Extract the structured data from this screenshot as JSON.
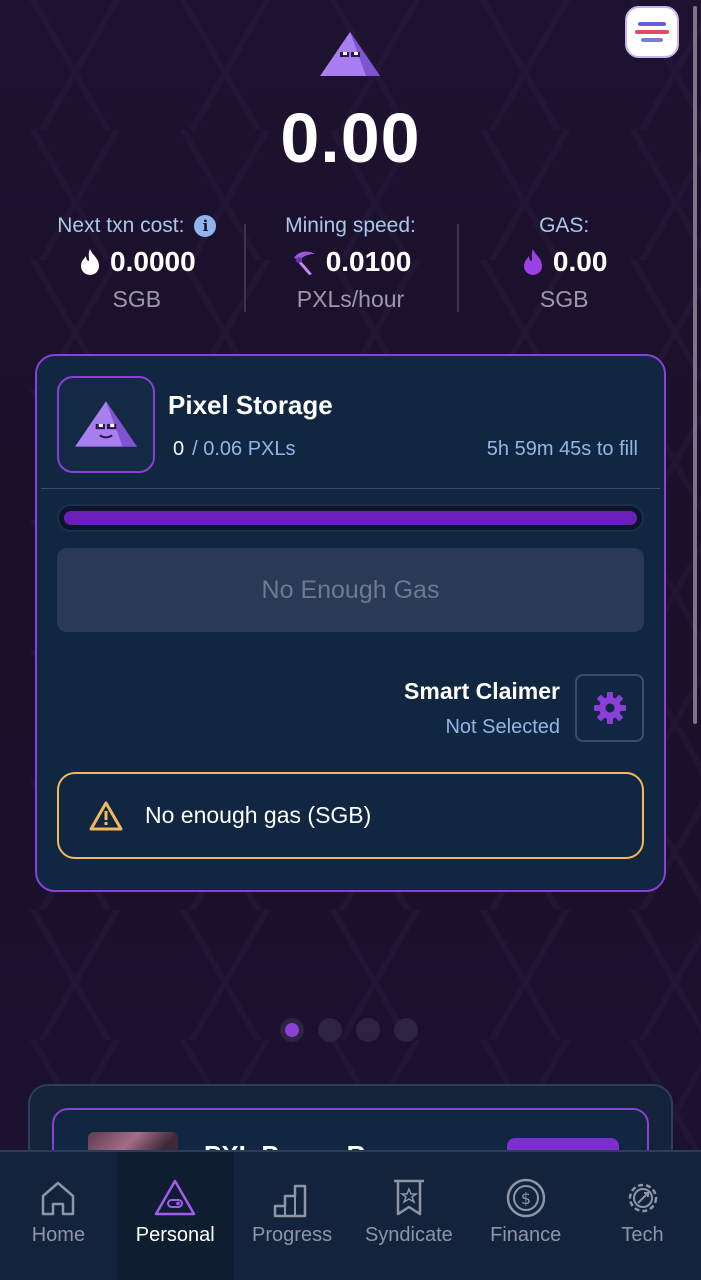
{
  "balance": "0.00",
  "stats": [
    {
      "label": "Next txn cost:",
      "has_info": true,
      "icon": "flame-icon",
      "value": "0.0000",
      "unit": "SGB"
    },
    {
      "label": "Mining speed:",
      "has_info": false,
      "icon": "pickaxe-icon",
      "value": "0.0100",
      "unit": "PXLs/hour"
    },
    {
      "label": "GAS:",
      "has_info": false,
      "icon": "purple-flame-icon",
      "value": "0.00",
      "unit": "SGB"
    }
  ],
  "storage": {
    "title": "Pixel Storage",
    "amount": "0",
    "capacity": "/ 0.06 PXLs",
    "time_to_fill": "5h 59m 45s to fill",
    "progress_fraction": 1.0,
    "button_label": "No Enough Gas",
    "claimer_title": "Smart Claimer",
    "claimer_status": "Not Selected",
    "warning_text": "No enough gas (SGB)"
  },
  "pager": {
    "count": 4,
    "active_index": 0
  },
  "peek_card": {
    "title": "PXL Power R..."
  },
  "tabs": [
    {
      "label": "Home",
      "icon": "home-icon",
      "active": false
    },
    {
      "label": "Personal",
      "icon": "triangle-mascot-icon",
      "active": true
    },
    {
      "label": "Progress",
      "icon": "stairs-icon",
      "active": false
    },
    {
      "label": "Syndicate",
      "icon": "banner-icon",
      "active": false
    },
    {
      "label": "Finance",
      "icon": "dollar-coin-icon",
      "active": false
    },
    {
      "label": "Tech",
      "icon": "gear-icon",
      "active": false
    }
  ],
  "colors": {
    "accent": "#8a3fd6",
    "warning": "#f2b85b",
    "card_bg": "#112640",
    "label_blue": "#8fb8e8"
  }
}
